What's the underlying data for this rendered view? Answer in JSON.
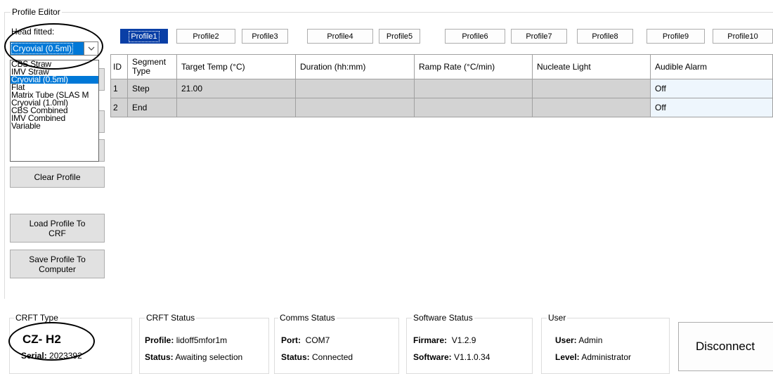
{
  "profile_editor": {
    "title": "Profile Editor",
    "head_fitted_label": "Head fitted:",
    "head_fitted_value": "Cryovial (0.5ml)",
    "head_options": [
      {
        "label": "CBS Straw",
        "selected": false
      },
      {
        "label": "IMV Straw",
        "selected": false
      },
      {
        "label": "Cryovial (0.5ml)",
        "selected": true
      },
      {
        "label": "Flat",
        "selected": false
      },
      {
        "label": "Matrix Tube (SLAS M",
        "selected": false
      },
      {
        "label": "Cryovial (1.0ml)",
        "selected": false
      },
      {
        "label": "CBS Combined",
        "selected": false
      },
      {
        "label": "IMV Combined",
        "selected": false
      },
      {
        "label": "Variable",
        "selected": false
      }
    ],
    "clear_profile": "Clear Profile",
    "load_profile_line1": "Load Profile To",
    "load_profile_line2": "CRF",
    "save_profile_line1": "Save Profile To",
    "save_profile_line2": "Computer"
  },
  "profile_tabs": [
    "Profile1",
    "Profile2",
    "Profile3",
    "Profile4",
    "Profile5",
    "Profile6",
    "Profile7",
    "Profile8",
    "Profile9",
    "Profile10"
  ],
  "active_tab": "Profile1",
  "grid": {
    "columns": [
      "ID",
      "Segment Type",
      "Target Temp (°C)",
      "Duration (hh:mm)",
      "Ramp Rate (°C/min)",
      "Nucleate Light",
      "Audible Alarm"
    ],
    "rows": [
      {
        "id": "1",
        "type": "Step",
        "target": "21.00",
        "duration": "",
        "ramp": "",
        "nucleate": "",
        "alarm": "Off"
      },
      {
        "id": "2",
        "type": "End",
        "target": "",
        "duration": "",
        "ramp": "",
        "nucleate": "",
        "alarm": "Off"
      }
    ]
  },
  "crft_type": {
    "title": "CRFT Type",
    "model": "CZ- H2",
    "serial_label": "Serial:",
    "serial_value": "2023392"
  },
  "crft_status": {
    "title": "CRFT Status",
    "profile_label": "Profile:",
    "profile_value": "lidoff5mfor1m",
    "status_label": "Status:",
    "status_value": "Awaiting selection"
  },
  "comms_status": {
    "title": "Comms Status",
    "port_label": "Port:",
    "port_value": "COM7",
    "status_label": "Status:",
    "status_value": "Connected"
  },
  "software_status": {
    "title": "Software Status",
    "firmware_label": "Firmare:",
    "firmware_value": "V1.2.9",
    "software_label": "Software:",
    "software_value": "V1.1.0.34"
  },
  "user": {
    "title": "User",
    "user_label": "User:",
    "user_value": "Admin",
    "level_label": "Level:",
    "level_value": "Administrator"
  },
  "disconnect": "Disconnect"
}
